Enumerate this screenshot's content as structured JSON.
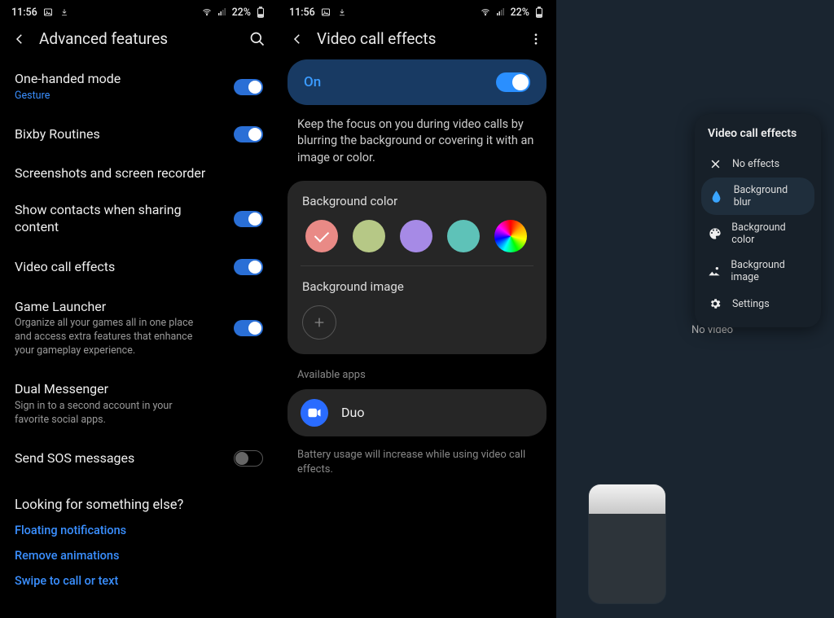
{
  "status": {
    "time": "11:56",
    "battery": "22%"
  },
  "panel1": {
    "title": "Advanced features",
    "items": {
      "oneHanded": {
        "title": "One-handed mode",
        "sub": "Gesture"
      },
      "bixby": {
        "title": "Bixby Routines"
      },
      "screenshots": {
        "title": "Screenshots and screen recorder"
      },
      "contacts": {
        "title": "Show contacts when sharing content"
      },
      "videoCall": {
        "title": "Video call effects"
      },
      "gameLauncher": {
        "title": "Game Launcher",
        "sub": "Organize all your games all in one place and access extra features that enhance your gameplay experience."
      },
      "dualMessenger": {
        "title": "Dual Messenger",
        "sub": "Sign in to a second account in your favorite social apps."
      },
      "sos": {
        "title": "Send SOS messages"
      }
    },
    "lookingFor": {
      "title": "Looking for something else?",
      "links": [
        "Floating notifications",
        "Remove animations",
        "Swipe to call or text"
      ]
    }
  },
  "panel2": {
    "title": "Video call effects",
    "on": "On",
    "desc": "Keep the focus on you during video calls by blurring the background or covering it with an image or color.",
    "bgColorLabel": "Background color",
    "swatches": [
      "#e98a86",
      "#b6c886",
      "#a68ae6",
      "#5ec2b8",
      "conic"
    ],
    "bgImageLabel": "Background image",
    "availableApps": "Available apps",
    "app": "Duo",
    "note": "Battery usage will increase while using video call effects."
  },
  "panel3": {
    "popupTitle": "Video call effects",
    "items": {
      "none": "No effects",
      "blur": "Background blur",
      "color": "Background color",
      "image": "Background image",
      "settings": "Settings"
    },
    "noVideo": "No video"
  }
}
